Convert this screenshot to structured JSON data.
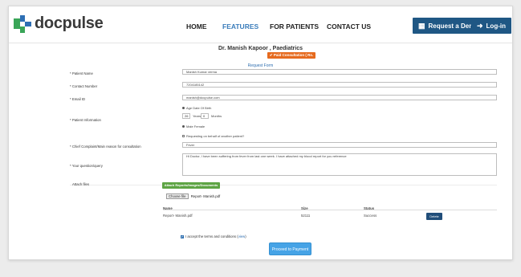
{
  "header": {
    "logo_text": "docpulse",
    "nav": [
      "HOME",
      "FEATURES",
      "FOR PATIENTS",
      "CONTACT US"
    ],
    "request_demo": "Request a Demo",
    "login": "Log-in"
  },
  "form": {
    "doctor": "Dr. Manish Kapoor , Paediatrics",
    "paid_badge": "✔ Paid Consultation ( Rs. 700)",
    "title": "Request Form",
    "labels": {
      "patient_name": "* Patient Name",
      "contact": "* Contact Number",
      "email": "* Email ID",
      "patient_info": "* Patient Information",
      "complaint": "* Chief Complaint/Main reason for consultation",
      "question": "* Your question/query",
      "attach": "Attach files"
    },
    "values": {
      "patient_name": "Manish Kumar verma",
      "contact": "7204185142",
      "email": "manish@docpulse.com",
      "age_years": "26",
      "age_months": "0",
      "complaint": "Fever",
      "question": "Hi Doctor, I have been suffering from fever from last one week. I have attached my blood report for you reference"
    },
    "age_option": "Age  Date Of Birth",
    "years_label": "Years",
    "months_label": "Months",
    "sex_option": "Male  Female",
    "on_behalf": "Requesting on behalf of another patient?",
    "attach_button": "Attach Reports/Images/Documents etc",
    "choose_file": "Choose file",
    "chosen_file_name": "Report- Manish.pdf",
    "table": {
      "headers": [
        "Name",
        "Size",
        "Status"
      ],
      "row": {
        "name": "Report- Manish.pdf",
        "size": "52111",
        "status": "Success",
        "delete": "Delete"
      }
    },
    "terms_prefix": "I accept the terms and conditions (",
    "terms_link": "view",
    "terms_suffix": ")",
    "proceed": "Proceed to Payment"
  }
}
